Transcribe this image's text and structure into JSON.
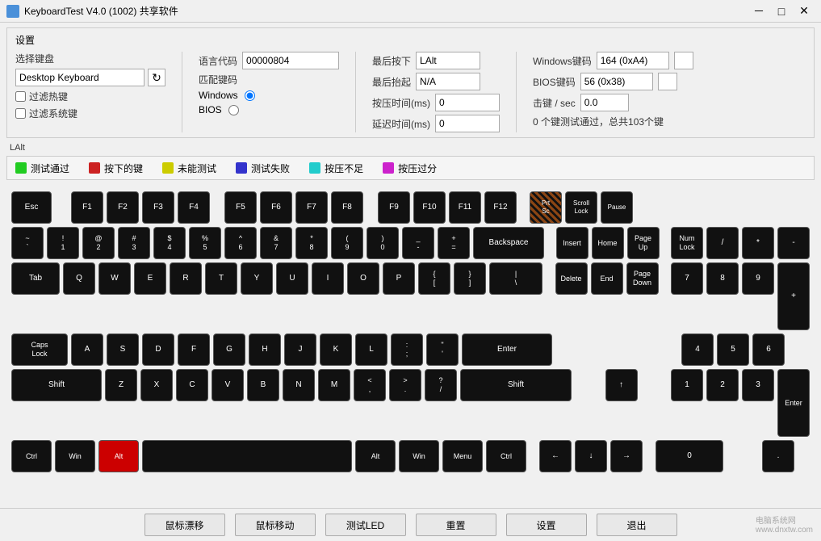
{
  "titleBar": {
    "title": "KeyboardTest V4.0 (1002) 共享软件",
    "icon": "⌨"
  },
  "settings": {
    "sectionLabel": "设置",
    "keyboardLabel": "选择键盘",
    "keyboardValue": "Desktop Keyboard",
    "languageCodeLabel": "语言代码",
    "languageCodeValue": "00000804",
    "matchCodeLabel": "匹配键码",
    "filterHotkeyLabel": "过滤热键",
    "filterSystemLabel": "过滤系统键",
    "windowsLabel": "Windows",
    "biosLabel": "BIOS",
    "lastPressLabel": "最后按下",
    "lastPressValue": "LAlt",
    "lastReleaseLabel": "最后抬起",
    "lastReleaseValue": "N/A",
    "pressTimeLabel": "按压时间(ms)",
    "pressTimeValue": "0",
    "delayTimeLabel": "延迟时间(ms)",
    "delayTimeValue": "0",
    "windowsKeyLabel": "Windows键码",
    "windowsKeyValue": "164 (0xA4)",
    "biosKeyLabel": "BIOS键码",
    "biosKeyValue": "56 (0x38)",
    "hitsPerSecLabel": "击键 / sec",
    "hitsPerSecValue": "0.0",
    "testPassedLabel": "0 个键测试通过，总共103个键"
  },
  "altLabel": "LAlt",
  "legend": {
    "items": [
      {
        "label": "测试通过",
        "color": "#22cc22"
      },
      {
        "label": "按下的键",
        "color": "#cc2222"
      },
      {
        "label": "未能测试",
        "color": "#cccc00"
      },
      {
        "label": "测试失败",
        "color": "#3333cc"
      },
      {
        "label": "按压不足",
        "color": "#22cccc"
      },
      {
        "label": "按压过分",
        "color": "#cc22cc"
      }
    ]
  },
  "keyboard": {
    "rows": []
  },
  "bottomButtons": [
    "鼠标漂移",
    "鼠标移动",
    "测试LED",
    "重置",
    "设置",
    "退出"
  ],
  "titleControls": {
    "minimize": "－",
    "maximize": "□",
    "close": "✕"
  }
}
